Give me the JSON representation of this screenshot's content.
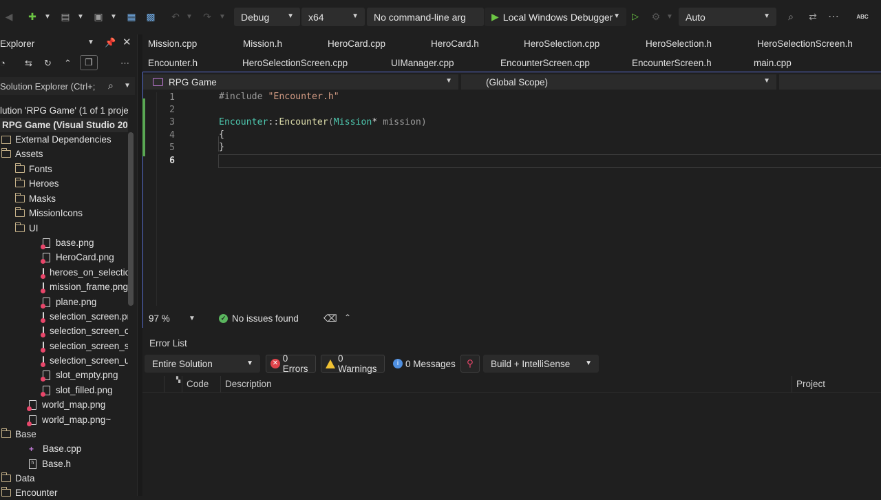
{
  "toolbar": {
    "config": "Debug",
    "platform": "x64",
    "args": "No command-line arg",
    "debugger": "Local Windows Debugger",
    "solution_config": "Auto",
    "spell_label": "ABC"
  },
  "solution_explorer": {
    "title": "Explorer",
    "search_placeholder": "Solution Explorer (Ctrl+;",
    "items": [
      {
        "label": "lution 'RPG Game' (1 of 1 proje",
        "icon": "solution-icon",
        "indent": 0
      },
      {
        "label": "RPG Game (Visual Studio 20",
        "icon": "project-icon",
        "indent": 0,
        "bold": true
      },
      {
        "label": "External Dependencies",
        "icon": "external-deps-icon",
        "indent": 0
      },
      {
        "label": "Assets",
        "icon": "folder-icon",
        "indent": 0
      },
      {
        "label": "Fonts",
        "icon": "folder-icon",
        "indent": 1
      },
      {
        "label": "Heroes",
        "icon": "folder-icon",
        "indent": 1
      },
      {
        "label": "Masks",
        "icon": "folder-icon",
        "indent": 1
      },
      {
        "label": "MissionIcons",
        "icon": "folder-icon",
        "indent": 1
      },
      {
        "label": "UI",
        "icon": "folder-icon",
        "indent": 1
      },
      {
        "label": "base.png",
        "icon": "image-file-icon",
        "indent": 2
      },
      {
        "label": "HeroCard.png",
        "icon": "image-file-icon",
        "indent": 2
      },
      {
        "label": "heroes_on_selectio",
        "icon": "image-file-icon",
        "indent": 2
      },
      {
        "label": "mission_frame.png",
        "icon": "image-file-icon",
        "indent": 2
      },
      {
        "label": "plane.png",
        "icon": "image-file-icon",
        "indent": 2
      },
      {
        "label": "selection_screen.pnc",
        "icon": "image-file-icon",
        "indent": 2
      },
      {
        "label": "selection_screen_on",
        "icon": "image-file-icon",
        "indent": 2
      },
      {
        "label": "selection_screen_sel",
        "icon": "image-file-icon",
        "indent": 2
      },
      {
        "label": "selection_screen_un",
        "icon": "image-file-icon",
        "indent": 2
      },
      {
        "label": "slot_empty.png",
        "icon": "image-file-icon",
        "indent": 2
      },
      {
        "label": "slot_filled.png",
        "icon": "image-file-icon",
        "indent": 2
      },
      {
        "label": "world_map.png",
        "icon": "image-file-icon",
        "indent": 1
      },
      {
        "label": "world_map.png~",
        "icon": "image-file-icon",
        "indent": 1
      },
      {
        "label": "Base",
        "icon": "folder-icon",
        "indent": 0
      },
      {
        "label": "Base.cpp",
        "icon": "cpp-file-icon",
        "indent": 1
      },
      {
        "label": "Base.h",
        "icon": "header-file-icon",
        "indent": 1
      },
      {
        "label": "Data",
        "icon": "folder-icon",
        "indent": 0
      },
      {
        "label": "Encounter",
        "icon": "folder-icon",
        "indent": 0
      }
    ]
  },
  "tabs": {
    "row1": [
      "Mission.cpp",
      "Mission.h",
      "HeroCard.cpp",
      "HeroCard.h",
      "HeroSelection.cpp",
      "HeroSelection.h",
      "HeroSelectionScreen.h"
    ],
    "row2": [
      "Encounter.h",
      "HeroSelectionScreen.cpp",
      "UIManager.cpp",
      "EncounterScreen.cpp",
      "EncounterScreen.h",
      "main.cpp"
    ]
  },
  "editor": {
    "project": "RPG Game",
    "scope": "(Global Scope)",
    "line_numbers": [
      "1",
      "2",
      "3",
      "4",
      "5",
      "6"
    ],
    "zoom": "97 %",
    "status": "No issues found",
    "code": {
      "l1_directive": "#include",
      "l1_string": "\"Encounter.h\"",
      "l3_class": "Encounter",
      "l3_sep": "::",
      "l3_fn": "Encounter",
      "l3_open": "(",
      "l3_type": "Mission",
      "l3_ptr": "*",
      "l3_param": " mission",
      "l3_close": ")",
      "l4": "{",
      "l5": "}"
    }
  },
  "error_list": {
    "title": "Error List",
    "scope": "Entire Solution",
    "errors": "0 Errors",
    "warnings": "0 Warnings",
    "messages": "0 Messages",
    "build": "Build + IntelliSense",
    "columns": [
      "Code",
      "Description",
      "Project"
    ]
  }
}
